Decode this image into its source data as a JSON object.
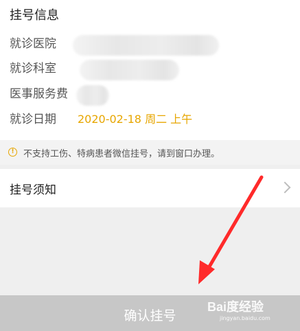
{
  "section": {
    "title": "挂号信息"
  },
  "rows": [
    {
      "label": "就诊医院"
    },
    {
      "label": "就诊科室"
    },
    {
      "label": "医事服务费"
    },
    {
      "label": "就诊日期",
      "value": "2020-02-18 周二 上午"
    }
  ],
  "notice": {
    "text": "不支持工伤、特病患者微信挂号，请到窗口办理。",
    "icon": "warning-icon"
  },
  "guide": {
    "label": "挂号须知",
    "icon": "chevron-right-icon"
  },
  "confirm": {
    "label": "确认挂号"
  },
  "watermark": {
    "logo": "Bai度经验",
    "url": "jingyan.baidu.com"
  },
  "colors": {
    "accent": "#e7a600",
    "arrow": "#ff2a2a",
    "disabled_button": "#c7c7c7"
  }
}
